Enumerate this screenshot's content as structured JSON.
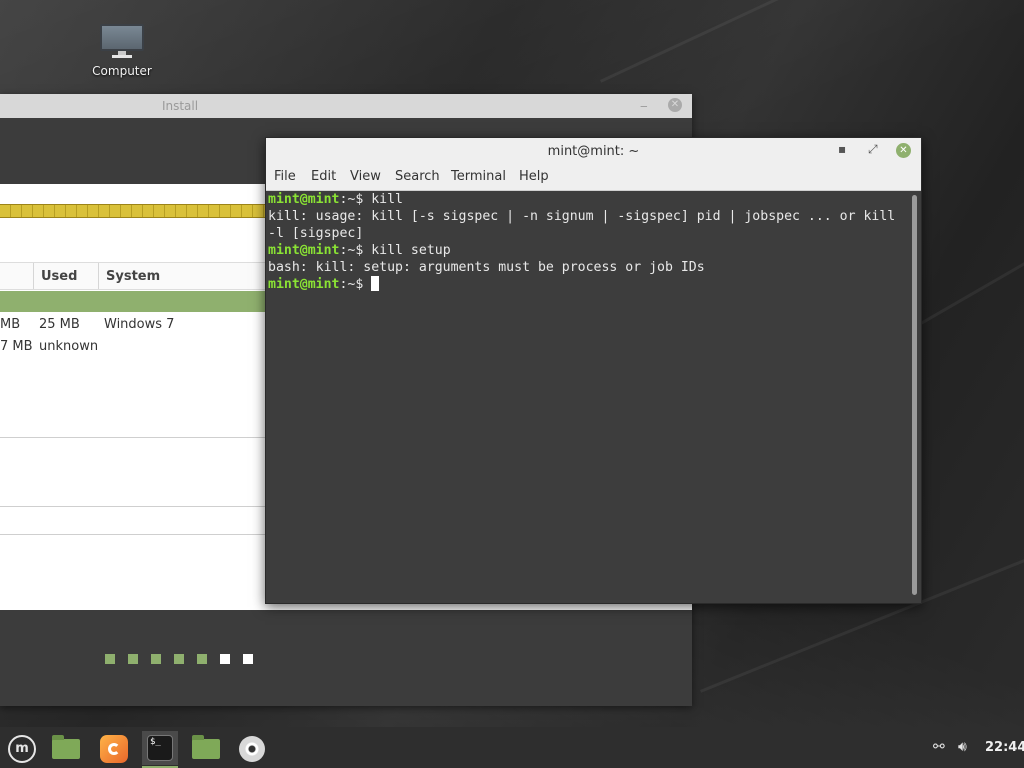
{
  "desktop": {
    "icons": [
      {
        "label": "Computer",
        "icon": "computer-icon"
      }
    ]
  },
  "install_window": {
    "title": "Install",
    "columns": [
      "Used",
      "System"
    ],
    "rows": [
      {
        "size": "MB",
        "used": "25 MB",
        "system": "Windows 7"
      },
      {
        "size": "7 MB",
        "used": "unknown",
        "system": ""
      }
    ],
    "progress_steps_total": 7,
    "progress_steps_done": 5,
    "accent_color": "#8fb06e"
  },
  "terminal": {
    "title": "mint@mint: ~",
    "menu": [
      "File",
      "Edit",
      "View",
      "Search",
      "Terminal",
      "Help"
    ],
    "prompt_user": "mint@mint",
    "prompt_suffix": ":~$",
    "lines": [
      {
        "type": "prompt",
        "command": " kill"
      },
      {
        "type": "output",
        "text": "kill: usage: kill [-s sigspec | -n signum | -sigspec] pid | jobspec ... or kill"
      },
      {
        "type": "output",
        "text": "-l [sigspec]"
      },
      {
        "type": "prompt",
        "command": " kill setup"
      },
      {
        "type": "output",
        "text": "bash: kill: setup: arguments must be process or job IDs"
      },
      {
        "type": "prompt",
        "command": " "
      }
    ],
    "prompt_color": "#8ae234"
  },
  "taskbar": {
    "launchers": [
      "mint-menu-icon",
      "show-desktop-icon",
      "firefox-icon",
      "terminal-icon",
      "files-icon",
      "disc-icon"
    ],
    "tray": [
      "network-icon",
      "volume-icon"
    ],
    "clock": "22:44"
  }
}
